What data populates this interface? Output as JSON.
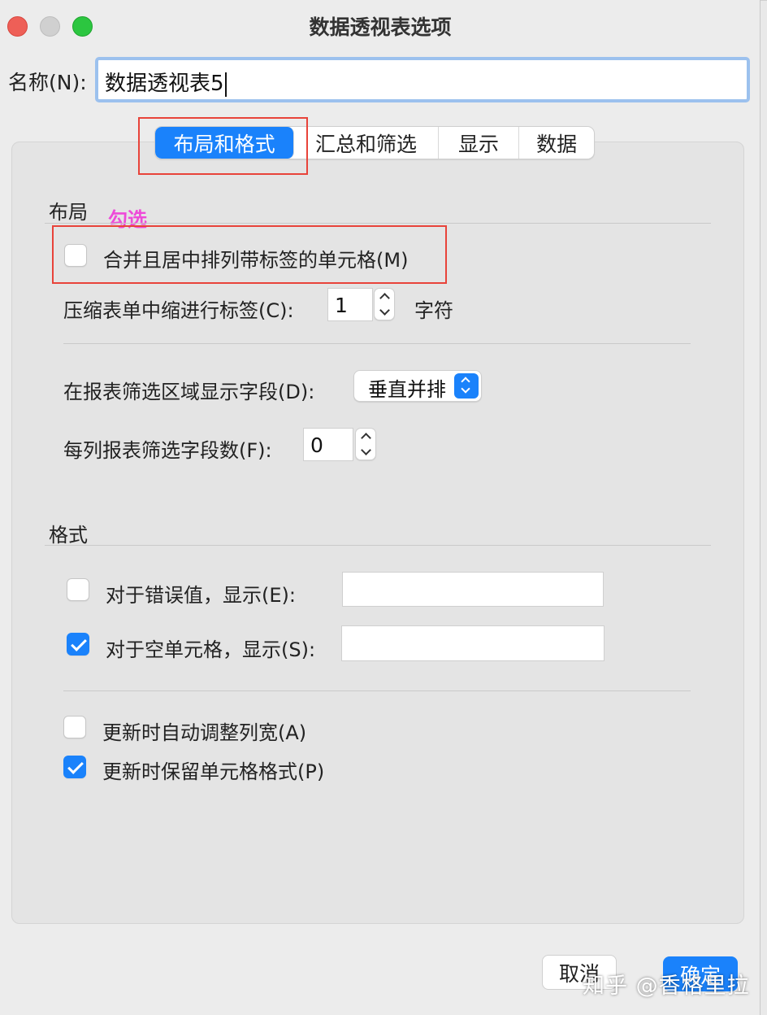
{
  "window": {
    "title": "数据透视表选项"
  },
  "name_field": {
    "label": "名称(N):",
    "value": "数据透视表5"
  },
  "tabs": [
    {
      "label": "布局和格式",
      "active": true
    },
    {
      "label": "汇总和筛选",
      "active": false
    },
    {
      "label": "显示",
      "active": false
    },
    {
      "label": "数据",
      "active": false
    }
  ],
  "annotation": {
    "text": "勾选",
    "color": "#ee4ad8",
    "box_color": "#e8433a"
  },
  "layout": {
    "title": "布局",
    "merge_center": {
      "label": "合并且居中排列带标签的单元格(M)",
      "checked": false
    },
    "indent": {
      "label": "压缩表单中缩进行标签(C):",
      "value": "1",
      "unit": "字符"
    },
    "filter_area": {
      "label": "在报表筛选区域显示字段(D):",
      "selected": "垂直并排"
    },
    "filter_fields_per_col": {
      "label": "每列报表筛选字段数(F):",
      "value": "0"
    }
  },
  "format": {
    "title": "格式",
    "error_values": {
      "label": "对于错误值，显示(E):",
      "checked": false,
      "value": ""
    },
    "empty_cells": {
      "label": "对于空单元格，显示(S):",
      "checked": true,
      "value": ""
    },
    "autofit": {
      "label": "更新时自动调整列宽(A)",
      "checked": false
    },
    "preserve_format": {
      "label": "更新时保留单元格格式(P)",
      "checked": true
    }
  },
  "buttons": {
    "cancel": "取消",
    "ok": "确定"
  },
  "watermark": "知乎 @香格里拉",
  "colors": {
    "accent": "#1a82fb",
    "window_bg": "#ececec"
  }
}
